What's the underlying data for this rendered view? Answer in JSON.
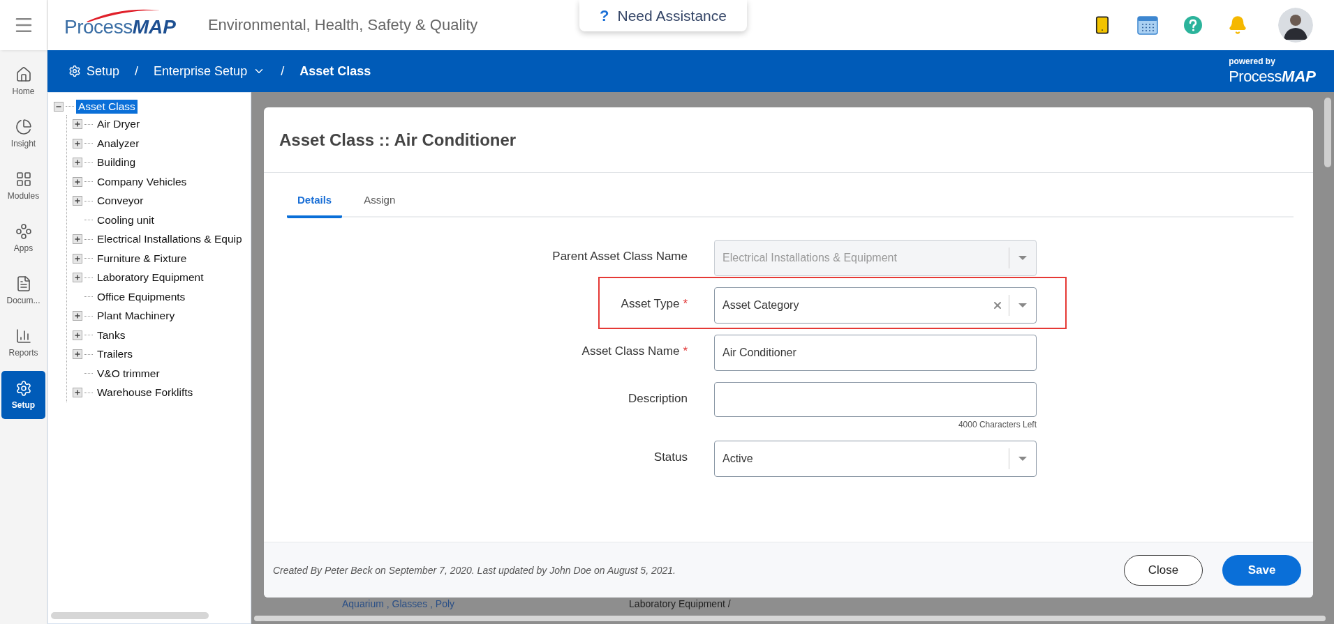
{
  "header": {
    "logo": {
      "part_a": "Process",
      "part_b": "MAP"
    },
    "subtitle": "Environmental, Health, Safety & Quality",
    "assistance": {
      "icon": "?",
      "label": "Need Assistance"
    }
  },
  "breadcrumb": {
    "items": [
      {
        "label": "Setup",
        "kind": "home"
      },
      {
        "label": "Enterprise Setup",
        "kind": "dropdown"
      },
      {
        "label": "Asset Class",
        "kind": "current"
      }
    ],
    "separator": "/",
    "powered_by": "powered by",
    "brand": {
      "part_a": "Process",
      "part_b": "MAP"
    }
  },
  "nav": [
    {
      "label": "Home",
      "kind": "home",
      "selected": false
    },
    {
      "label": "Insight",
      "kind": "insight",
      "selected": false
    },
    {
      "label": "Modules",
      "kind": "modules",
      "selected": false
    },
    {
      "label": "Apps",
      "kind": "apps",
      "selected": false
    },
    {
      "label": "Docum...",
      "kind": "documents",
      "selected": false
    },
    {
      "label": "Reports",
      "kind": "reports",
      "selected": false
    },
    {
      "label": "Setup",
      "kind": "setup",
      "selected": true
    }
  ],
  "tree": {
    "label": "Asset Class",
    "selected": true,
    "expanded": true,
    "children": [
      {
        "label": "Air Dryer",
        "kind": "folder",
        "selected": false
      },
      {
        "label": "Analyzer",
        "kind": "folder",
        "selected": false
      },
      {
        "label": "Building",
        "kind": "folder",
        "selected": false
      },
      {
        "label": "Company Vehicles",
        "kind": "folder",
        "selected": false
      },
      {
        "label": "Conveyor",
        "kind": "folder",
        "selected": false
      },
      {
        "label": "Cooling unit",
        "kind": "leaf",
        "selected": false
      },
      {
        "label": "Electrical Installations & Equip",
        "kind": "folder",
        "selected": false
      },
      {
        "label": "Furniture & Fixture",
        "kind": "folder",
        "selected": false
      },
      {
        "label": "Laboratory Equipment",
        "kind": "folder",
        "selected": false
      },
      {
        "label": "Office Equipments",
        "kind": "leaf",
        "selected": false
      },
      {
        "label": "Plant Machinery",
        "kind": "folder",
        "selected": false
      },
      {
        "label": "Tanks",
        "kind": "folder",
        "selected": false
      },
      {
        "label": "Trailers",
        "kind": "folder",
        "selected": false
      },
      {
        "label": "V&O trimmer",
        "kind": "leaf",
        "selected": false
      },
      {
        "label": "Warehouse Forklifts",
        "kind": "folder",
        "selected": false
      }
    ]
  },
  "background_row": [
    "Aquarium , Glasses , Poly",
    "Laboratory Equipment /"
  ],
  "modal": {
    "title": "Asset Class :: Air Conditioner",
    "tabs": [
      {
        "label": "Details",
        "selected": true
      },
      {
        "label": "Assign",
        "selected": false
      }
    ],
    "fields": [
      {
        "label": "Parent Asset Class Name",
        "kind": "select",
        "value": "Electrical Installations & Equipment",
        "disabled": true
      },
      {
        "label": "Asset Type",
        "kind": "select",
        "value": "Asset Category",
        "required": true,
        "disabled": false,
        "clearable": true,
        "highlighted": true
      },
      {
        "label": "Asset Class Name",
        "kind": "text",
        "value": "Air Conditioner",
        "required": true,
        "disabled": false
      },
      {
        "label": "Description",
        "kind": "textarea",
        "hint": "4000 Characters Left",
        "disabled": false
      },
      {
        "label": "Status",
        "kind": "select",
        "value": "Active",
        "disabled": false
      }
    ],
    "required_mark": "*",
    "footer_note": "Created By Peter Beck on September 7, 2020. Last updated by John Doe on August 5, 2021.",
    "buttons": [
      {
        "label": "Close",
        "kind": "secondary"
      },
      {
        "label": "Save",
        "kind": "primary"
      }
    ]
  }
}
